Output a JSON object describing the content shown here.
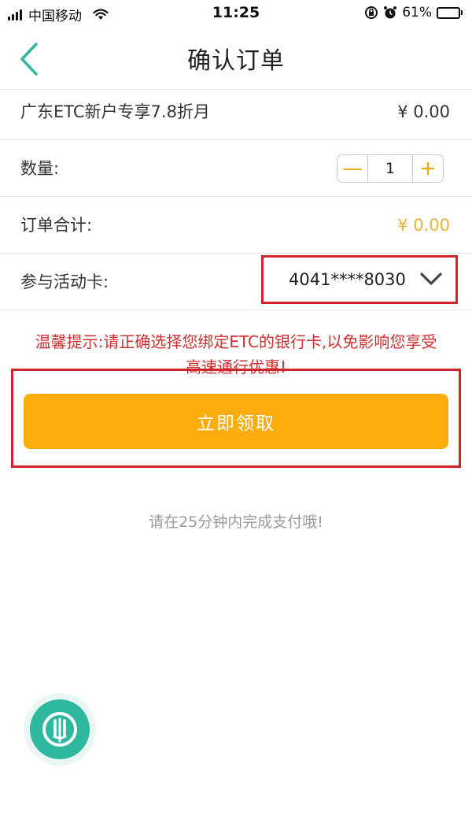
{
  "status_bar": {
    "carrier": "中国移动",
    "time": "11:25",
    "battery_percent": "61%",
    "battery_level": 0.61,
    "icons": [
      "signal-icon",
      "wifi-icon",
      "rotation-lock-icon",
      "alarm-icon",
      "battery-icon"
    ]
  },
  "nav": {
    "title": "确认订单",
    "back_icon": "chevron-left-icon"
  },
  "order": {
    "product_name": "广东ETC新户专享7.8折月",
    "product_price": "¥ 0.00",
    "quantity_label": "数量:",
    "quantity_value": "1",
    "minus_symbol": "—",
    "plus_symbol": "+",
    "total_label": "订单合计:",
    "total_value": "¥ 0.00",
    "card_label": "参与活动卡:",
    "card_number": "4041****8030"
  },
  "tip": "温馨提示:请正确选择您绑定ETC的银行卡,以免影响您享受高速通行优惠!",
  "claim_button": "立即领取",
  "pay_note": "请在25分钟内完成支付哦!",
  "colors": {
    "accent_teal": "#2fb8a0",
    "button_orange": "#fbad0d",
    "price_gold": "#e8b33a",
    "tip_red": "#d3302f",
    "highlight_red": "#d0242b"
  }
}
